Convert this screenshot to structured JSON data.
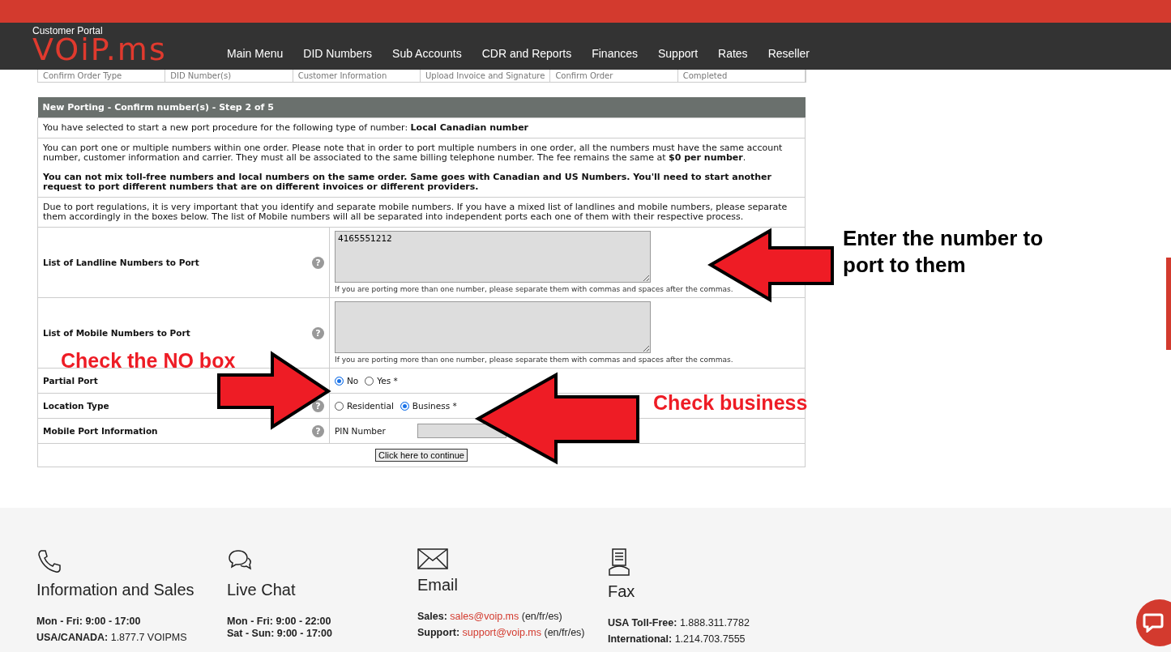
{
  "header": {
    "portal_label": "Customer Portal",
    "logo_text": "VOiP.ms"
  },
  "nav": [
    {
      "label": "Main Menu"
    },
    {
      "label": "DID Numbers"
    },
    {
      "label": "Sub Accounts"
    },
    {
      "label": "CDR and Reports"
    },
    {
      "label": "Finances"
    },
    {
      "label": "Support"
    },
    {
      "label": "Rates"
    },
    {
      "label": "Reseller"
    }
  ],
  "steps": [
    "Confirm Order Type",
    "DID Number(s)",
    "Customer Information",
    "Upload Invoice and Signature",
    "Confirm Order",
    "Completed"
  ],
  "form": {
    "title": "New Porting - Confirm number(s) - Step 2 of 5",
    "intro": "You have selected to start a new port procedure for the following type of number: **Local Canadian number**",
    "notes": [
      {
        "text": "You can port one or multiple numbers within one order. Please note that in order to port multiple numbers in one order, all the numbers must have the same account number, customer information and carrier. They must all be associated to the same billing telephone number. The fee remains the same at **$0 per number**.",
        "warning": "You can not mix toll-free numbers and local numbers on the same order. Same goes with Canadian and US Numbers. You'll need to start another request to port different numbers that are on different invoices or different providers."
      },
      {
        "text": "Due to port regulations, it is very important that you identify and separate mobile numbers. If you have a mixed list of landlines and mobile numbers, please separate them accordingly in the boxes below. The list of Mobile numbers will all be separated into independent ports each one of them with their respective process."
      }
    ],
    "fields": [
      {
        "kind": "textarea",
        "label": "List of Landline Numbers to Port",
        "help": "?",
        "value": "4165551212",
        "hint": "If you are porting more than one number, please separate them with commas and spaces after the commas."
      },
      {
        "kind": "textarea",
        "label": "List of Mobile Numbers to Port",
        "help": "?",
        "hint": "If you are porting more than one number, please separate them with commas and spaces after the commas."
      },
      {
        "kind": "radio",
        "label": "Partial Port",
        "options": [
          {
            "label": "No",
            "selected": true
          },
          {
            "label": "Yes *",
            "selected": false
          }
        ]
      },
      {
        "kind": "radio",
        "label": "Location Type",
        "help": "?",
        "options": [
          {
            "label": "Residential",
            "selected": false
          },
          {
            "label": "Business *",
            "selected": true
          }
        ]
      },
      {
        "kind": "pin",
        "label": "Mobile Port Information",
        "help": "?",
        "field_label": "PIN Number"
      }
    ],
    "submit": "Click here to continue"
  },
  "annotations": [
    {
      "text": "Enter the number to port to them",
      "kind": "black"
    },
    {
      "text": "Check the NO box",
      "kind": "red"
    },
    {
      "text": "Check business",
      "kind": "red"
    }
  ],
  "footer": [
    {
      "kind": "phone",
      "heading": "Information and Sales",
      "lines": [
        {
          "label": "Mon - Fri: 9:00 - 17:00"
        },
        {
          "label": "USA/CANADA:",
          "text": "1.877.7 VOIPMS"
        }
      ]
    },
    {
      "kind": "chat",
      "heading": "Live Chat",
      "lines": [
        {
          "label": "Mon - Fri: 9:00 - 22:00"
        },
        {
          "label": "Sat - Sun: 9:00 - 17:00"
        }
      ]
    },
    {
      "kind": "email",
      "heading": "Email",
      "lines": [
        {
          "label": "Sales:",
          "link": "sales@voip.ms",
          "text": "(en/fr/es)"
        },
        {
          "label": "Support:",
          "link": "support@voip.ms",
          "text": "(en/fr/es)"
        }
      ]
    },
    {
      "kind": "fax",
      "heading": "Fax",
      "lines": [
        {
          "label": "USA Toll-Free:",
          "text": "1.888.311.7782"
        },
        {
          "label": "International:",
          "text": "1.214.703.7555"
        }
      ]
    }
  ]
}
